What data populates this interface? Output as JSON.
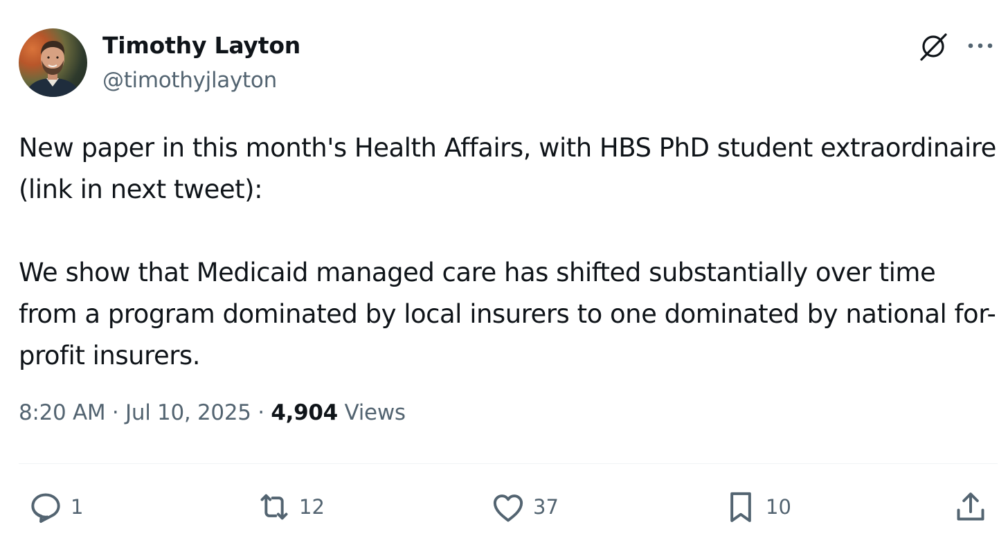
{
  "author": {
    "display_name": "Timothy Layton",
    "handle": "@timothyjlayton"
  },
  "tweet": {
    "paragraphs": [
      "New paper in this month's Health Affairs, with HBS PhD student extraordinaire  (link in next tweet):",
      "We show that Medicaid managed care has shifted substantially over time from a program dominated by local insurers to one dominated by national for-profit insurers."
    ]
  },
  "meta": {
    "time": "8:20 AM",
    "separator": " · ",
    "date": "Jul 10, 2025",
    "views_count": "4,904",
    "views_label": "Views"
  },
  "actions": {
    "reply": {
      "icon": "reply-icon",
      "count": "1"
    },
    "retweet": {
      "icon": "retweet-icon",
      "count": "12"
    },
    "like": {
      "icon": "heart-icon",
      "count": "37"
    },
    "bookmark": {
      "icon": "bookmark-icon",
      "count": "10"
    },
    "share": {
      "icon": "share-icon"
    }
  },
  "colors": {
    "text_primary": "#0f1419",
    "text_secondary": "#536471",
    "divider": "#eff3f4"
  }
}
